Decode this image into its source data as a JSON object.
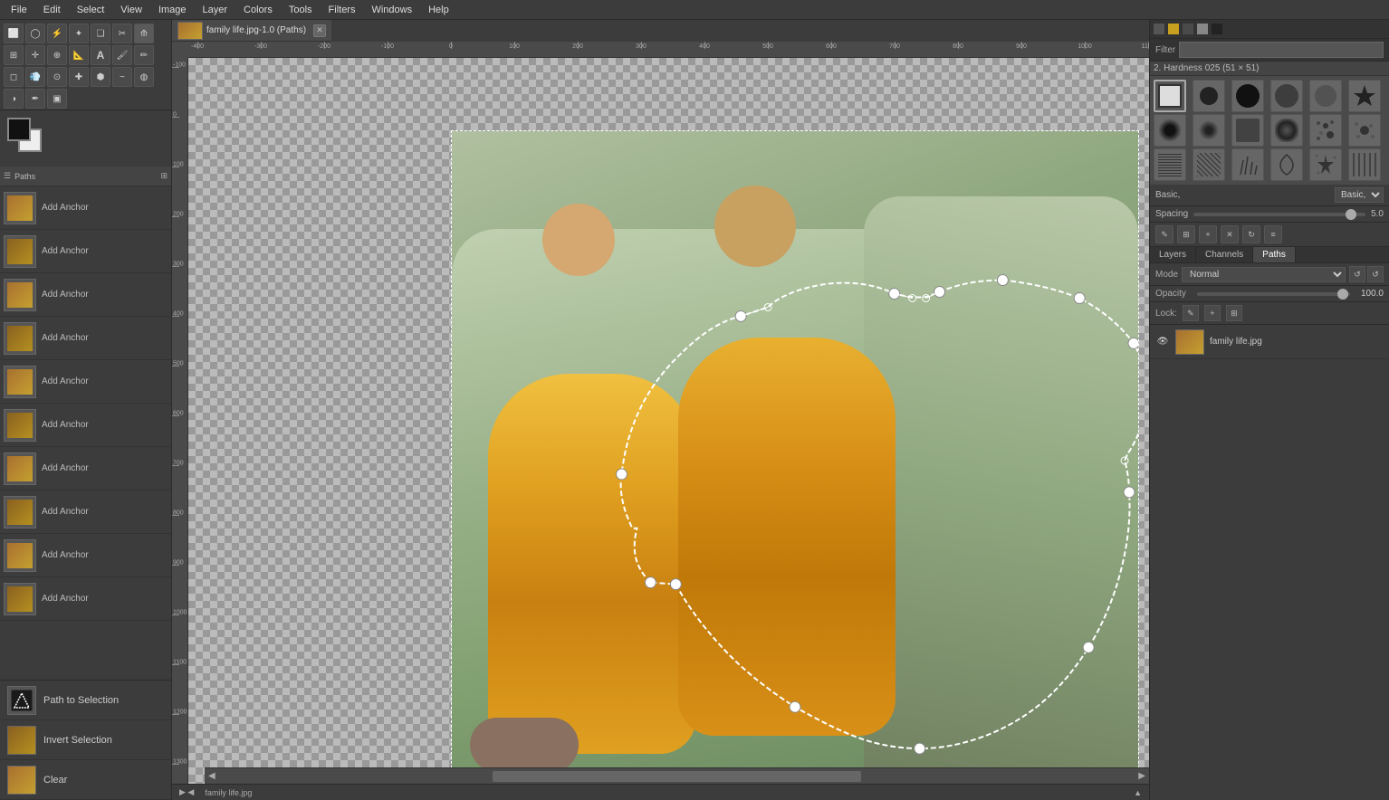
{
  "menubar": {
    "items": [
      "File",
      "Edit",
      "Select",
      "View",
      "Image",
      "Layer",
      "Colors",
      "Tools",
      "Filters",
      "Windows",
      "Help"
    ]
  },
  "toolbar": {
    "tools": [
      {
        "name": "rectangle-select",
        "icon": "⬜"
      },
      {
        "name": "ellipse-select",
        "icon": "◯"
      },
      {
        "name": "free-select",
        "icon": "⚡"
      },
      {
        "name": "fuzzy-select",
        "icon": "✦"
      },
      {
        "name": "select-by-color",
        "icon": "❏"
      },
      {
        "name": "scissors-select",
        "icon": "✂"
      },
      {
        "name": "paths-tool",
        "icon": "⟰"
      },
      {
        "name": "transform-tool",
        "icon": "⊞"
      },
      {
        "name": "move-tool",
        "icon": "✛"
      },
      {
        "name": "zoom-tool",
        "icon": "⊕"
      },
      {
        "name": "measure-tool",
        "icon": "📏"
      },
      {
        "name": "text-tool",
        "icon": "A"
      },
      {
        "name": "paintbrush",
        "icon": "🖌"
      },
      {
        "name": "pencil",
        "icon": "✏"
      },
      {
        "name": "eraser",
        "icon": "◻"
      },
      {
        "name": "airbrush",
        "icon": "💨"
      },
      {
        "name": "clone",
        "icon": "⊙"
      },
      {
        "name": "heal",
        "icon": "✚"
      },
      {
        "name": "perspective-clone",
        "icon": "⬢"
      },
      {
        "name": "smudge",
        "icon": "~"
      },
      {
        "name": "blur-sharpen",
        "icon": "◍"
      },
      {
        "name": "dodge-burn",
        "icon": "◑"
      },
      {
        "name": "ink",
        "icon": "✒"
      },
      {
        "name": "fill",
        "icon": "▣"
      }
    ],
    "fg_color": "#111111",
    "bg_color": "#eeeeee"
  },
  "layer_panel": {
    "items": [
      {
        "label": "Add Anchor",
        "has_thumb": true
      },
      {
        "label": "Add Anchor",
        "has_thumb": true
      },
      {
        "label": "Add Anchor",
        "has_thumb": true
      },
      {
        "label": "Add Anchor",
        "has_thumb": true
      },
      {
        "label": "Add Anchor",
        "has_thumb": true
      },
      {
        "label": "Add Anchor",
        "has_thumb": true
      },
      {
        "label": "Add Anchor",
        "has_thumb": true
      },
      {
        "label": "Add Anchor",
        "has_thumb": true
      },
      {
        "label": "Add Anchor",
        "has_thumb": true
      },
      {
        "label": "Add Anchor",
        "has_thumb": true
      }
    ],
    "bottom_buttons": [
      {
        "label": "Path to Selection",
        "has_dark_thumb": true
      },
      {
        "label": "Invert Selection",
        "has_dark_thumb": false
      },
      {
        "label": "Clear",
        "has_dark_thumb": false
      }
    ]
  },
  "canvas": {
    "doc_title": "family life.jpg-1.0 (Paths)",
    "ruler_ticks": [
      "I500",
      "I000",
      "I500",
      "I000",
      "I500",
      "I000",
      "I500"
    ],
    "ruler_values": [
      "-300",
      "-200",
      "-100",
      "0",
      "100",
      "200",
      "300"
    ]
  },
  "brush_panel": {
    "filter_label": "Filter",
    "filter_placeholder": "",
    "brush_title": "2. Hardness 025 (51 × 51)",
    "category": "Basic,",
    "spacing_label": "Spacing",
    "spacing_value": "5.0"
  },
  "layer_tabs": {
    "tabs": [
      "Layers",
      "Channels",
      "Paths"
    ],
    "active": "Layers"
  },
  "layers_section": {
    "mode_label": "Mode",
    "mode_value": "Normal",
    "opacity_label": "Opacity",
    "opacity_value": "100.0",
    "lock_label": "Lock:",
    "layer_name": "family life.jpg"
  }
}
